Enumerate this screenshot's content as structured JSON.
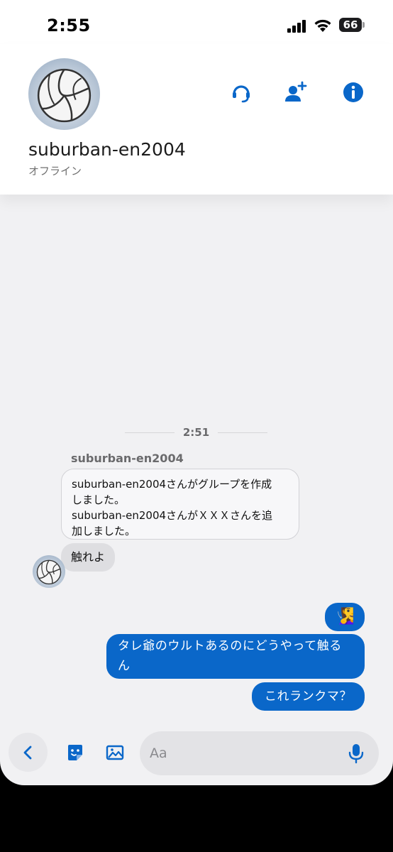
{
  "status_bar": {
    "time": "2:55",
    "battery": "66"
  },
  "header": {
    "name": "suburban-en2004",
    "status": "オフライン",
    "icons": [
      "headset-icon",
      "add-user-icon",
      "info-icon"
    ],
    "accent_color": "#0a67c9"
  },
  "chat": {
    "timestamp": "2:51",
    "sender_name": "suburban-en2004",
    "system_lines": [
      "suburban-en2004さんがグループを作成",
      "しました。",
      "suburban-en2004さんがＸＸＸさんを追",
      "加しました。"
    ],
    "incoming_message": "触れよ",
    "outgoing_emoji": "🧏‍♀️",
    "outgoing_messages": [
      "タレ爺のウルトあるのにどうやって触るん",
      "これランクマ？"
    ]
  },
  "input_bar": {
    "placeholder": "Aa",
    "icons": [
      "back-icon",
      "sticker-icon",
      "image-icon",
      "mic-icon"
    ]
  }
}
